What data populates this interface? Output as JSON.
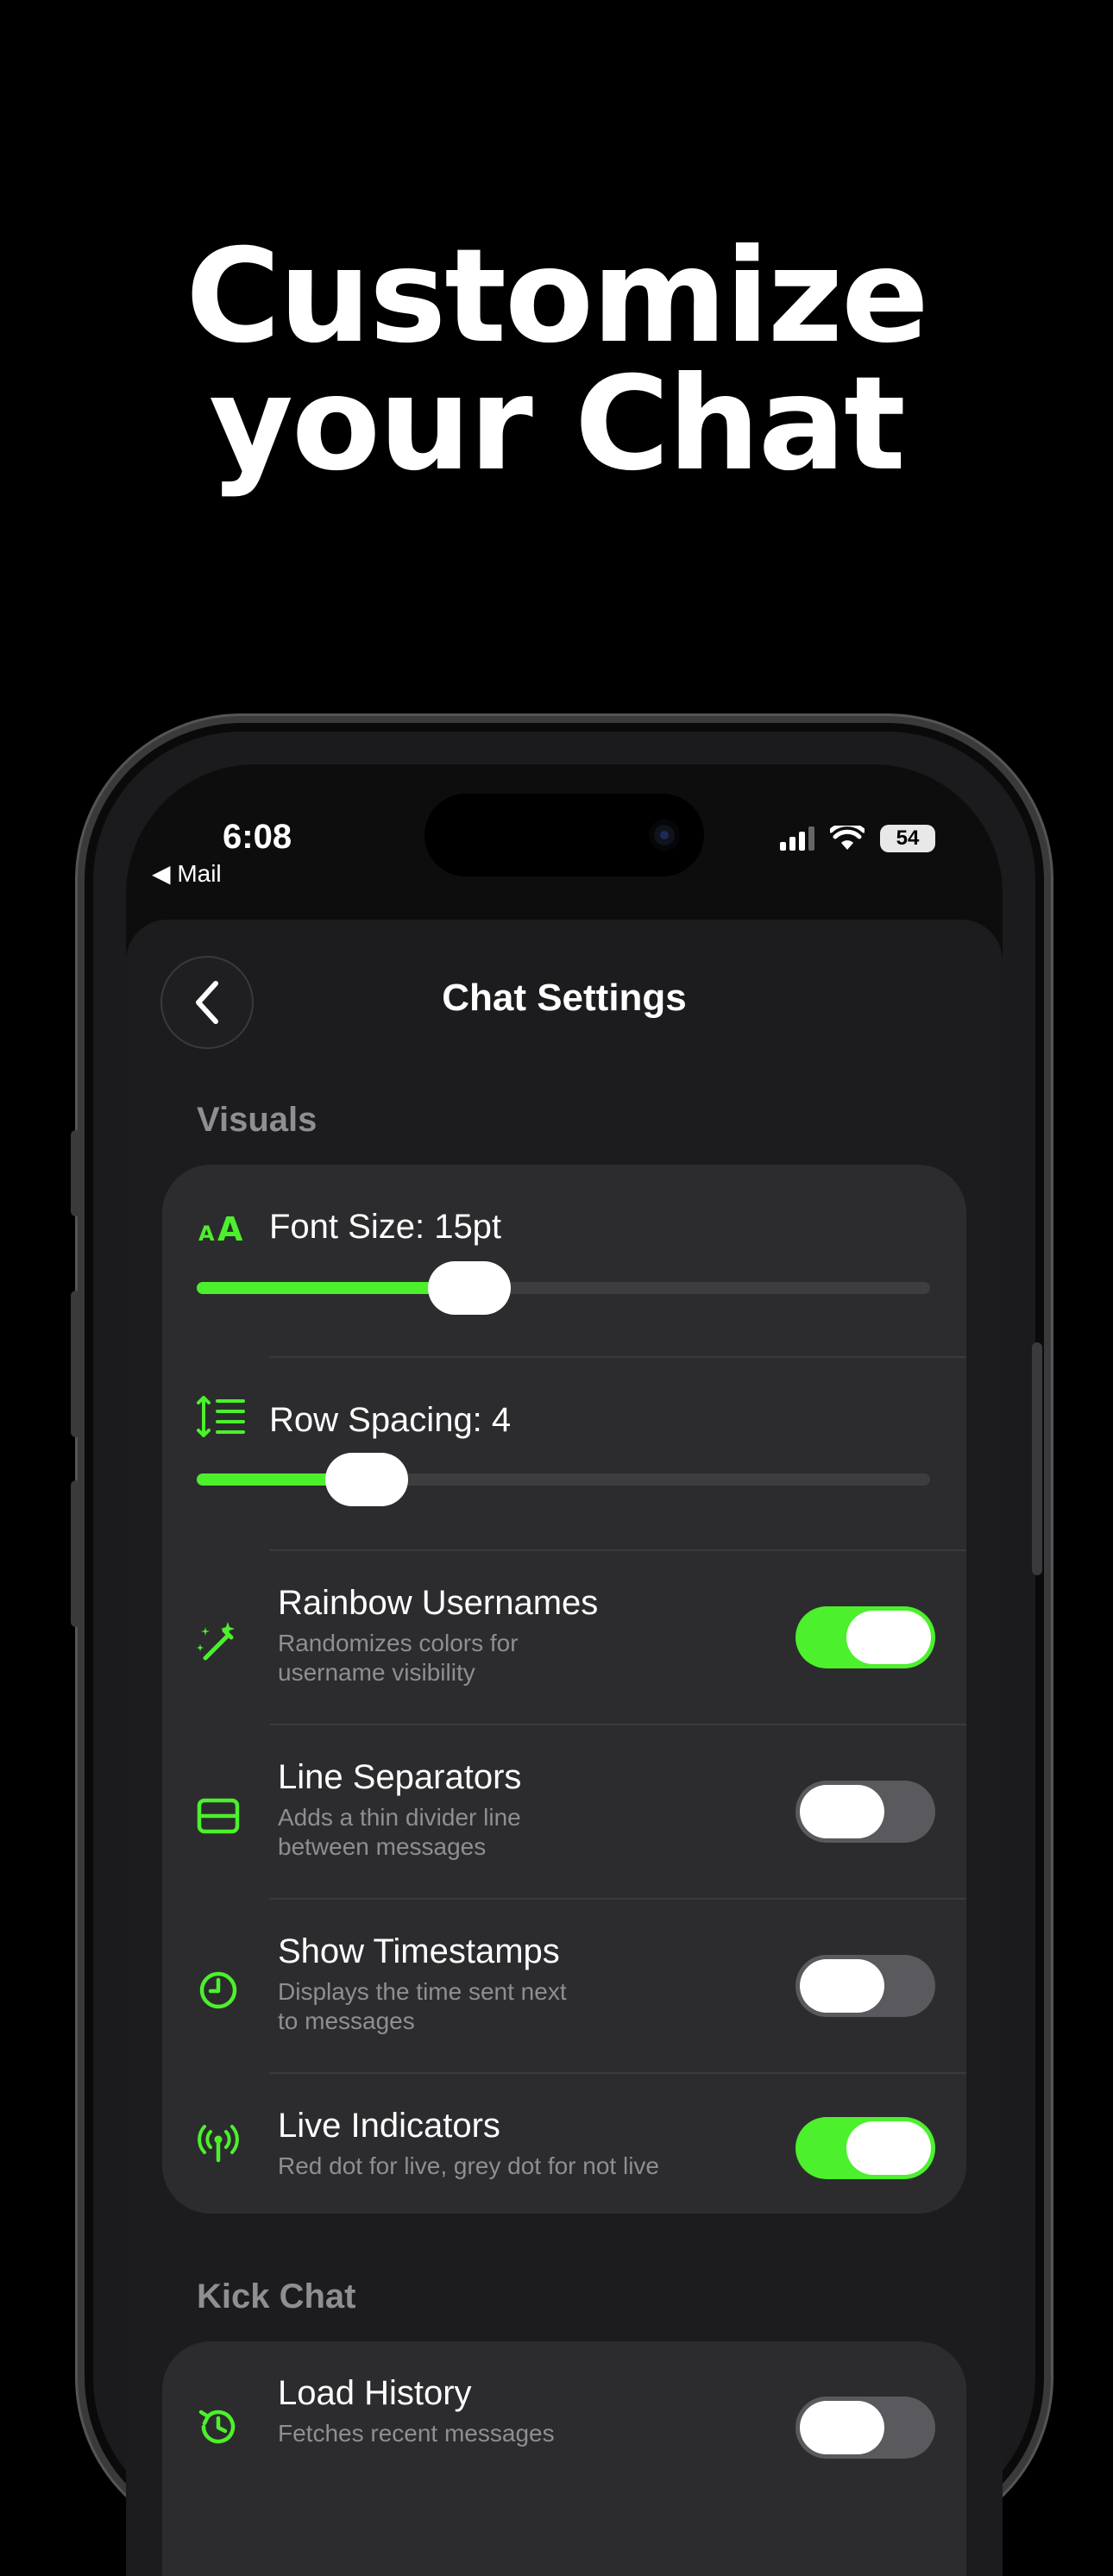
{
  "headline": {
    "line1": "Customize",
    "line2": "your Chat"
  },
  "status_bar": {
    "time": "6:08",
    "back_label": "◀ Mail",
    "battery": "54"
  },
  "header": {
    "title": "Chat Settings"
  },
  "sections": {
    "visuals": "Visuals",
    "kick_chat": "Kick Chat"
  },
  "sliders": {
    "font_size": {
      "label": "Font Size: 15pt",
      "fraction": 0.372
    },
    "row_spacing": {
      "label": "Row Spacing: 4",
      "fraction": 0.232
    }
  },
  "toggles": {
    "rainbow": {
      "title": "Rainbow Usernames",
      "subtitle": "Randomizes colors for\nusername visibility",
      "on": true
    },
    "separators": {
      "title": "Line Separators",
      "subtitle": "Adds a thin divider line\nbetween messages",
      "on": false
    },
    "timestamps": {
      "title": "Show Timestamps",
      "subtitle": "Displays the time sent next\nto messages",
      "on": false
    },
    "live": {
      "title": "Live Indicators",
      "subtitle": "Red dot for live, grey dot for not live",
      "on": true
    },
    "history": {
      "title": "Load History",
      "subtitle": "Fetches recent messages",
      "on": false
    }
  },
  "colors": {
    "accent": "#4cf02c",
    "card": "#2c2c2e",
    "sheet": "#1c1c1e",
    "subtext": "#8e8e93"
  },
  "icons": {
    "font": "font-size-icon",
    "spacing": "line-spacing-icon",
    "rainbow": "magic-wand-icon",
    "separators": "card-divider-icon",
    "timestamps": "clock-icon",
    "live": "broadcast-icon",
    "history": "history-clock-icon"
  }
}
